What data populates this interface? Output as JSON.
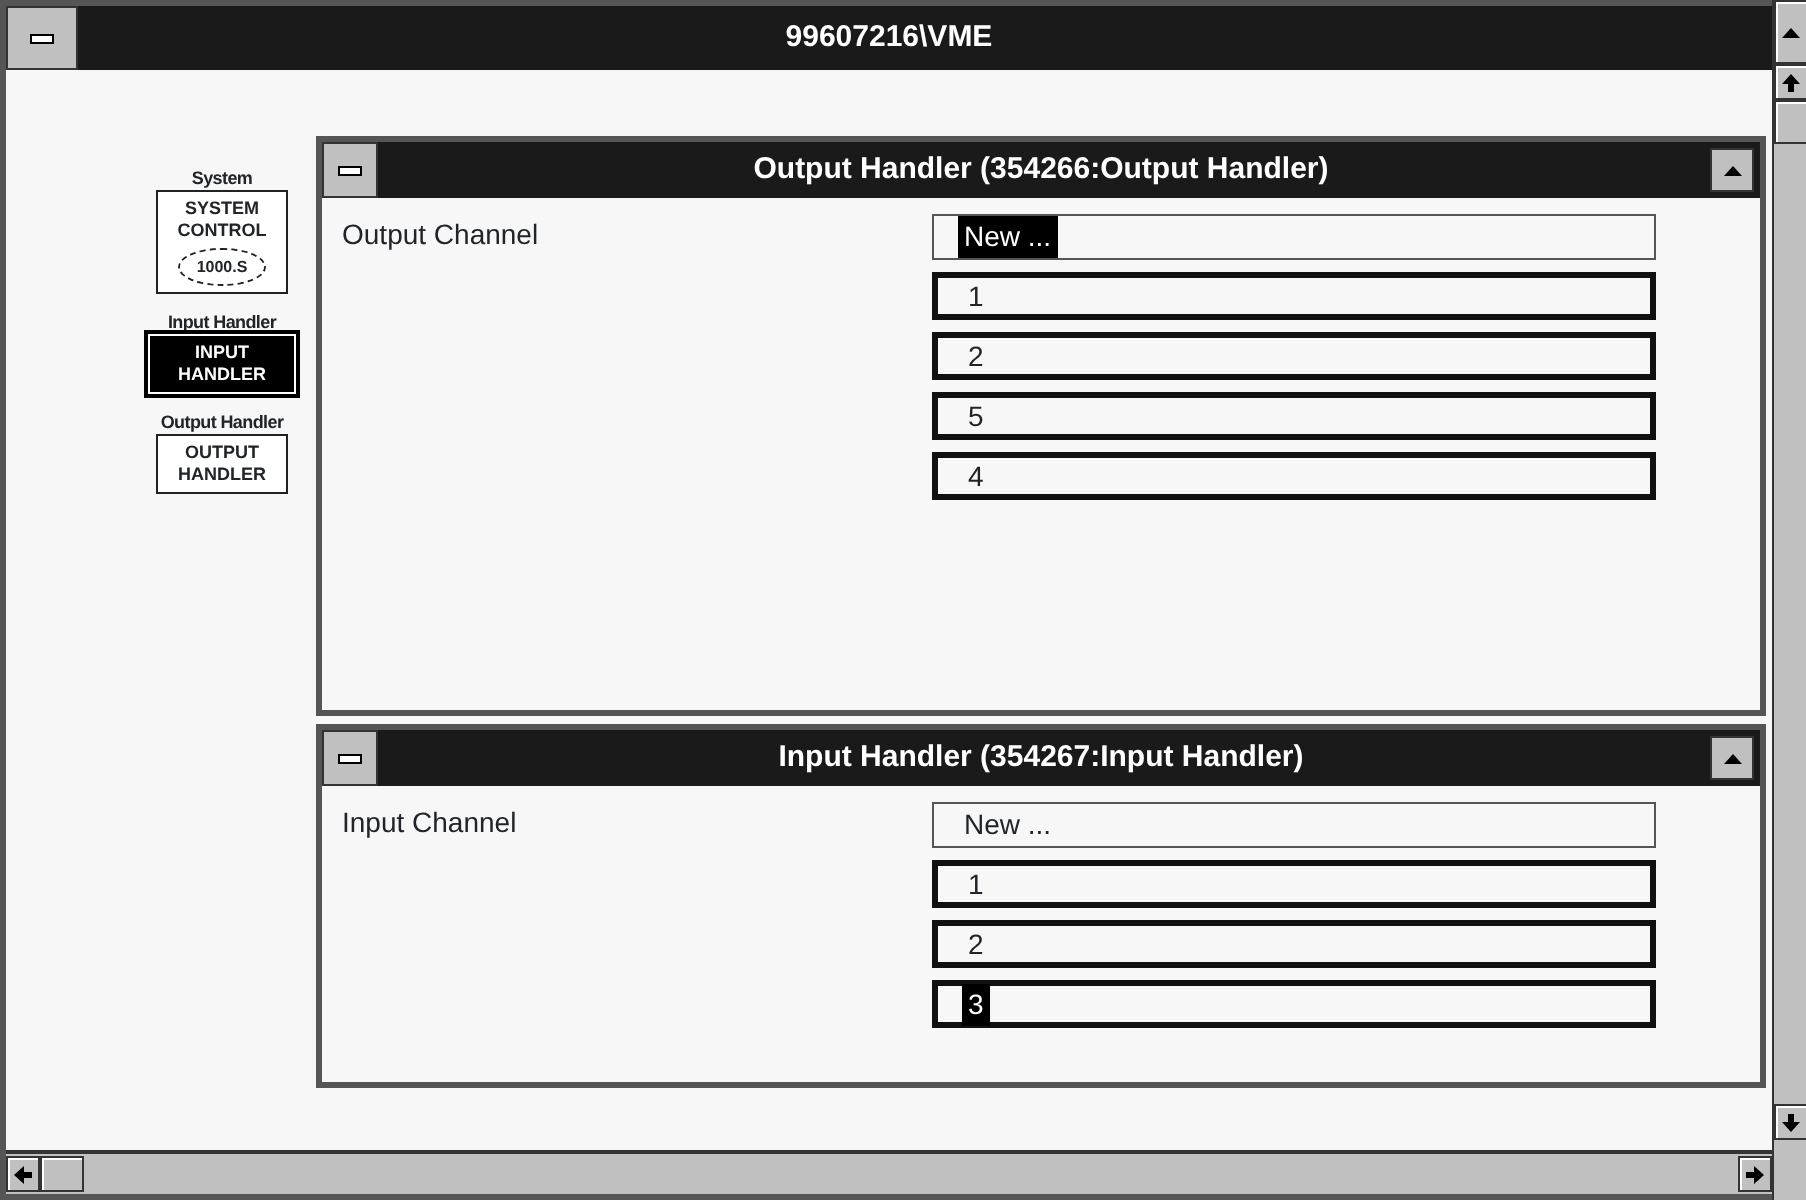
{
  "window": {
    "title": "99607216\\VME"
  },
  "icons": [
    {
      "label": "System",
      "lines": [
        "SYSTEM",
        "CONTROL"
      ],
      "badge": "1000.S",
      "selected": false
    },
    {
      "label": "Input Handler",
      "lines": [
        "INPUT",
        "HANDLER"
      ],
      "selected": true
    },
    {
      "label": "Output Handler",
      "lines": [
        "OUTPUT",
        "HANDLER"
      ],
      "selected": false
    }
  ],
  "child_windows": [
    {
      "title": "Output Handler (354266:Output Handler)",
      "field_label": "Output Channel",
      "entries": [
        {
          "kind": "new",
          "text": "New ...",
          "selected": true
        },
        {
          "kind": "channel",
          "text": "1",
          "selected": false
        },
        {
          "kind": "channel",
          "text": "2",
          "selected": false
        },
        {
          "kind": "channel",
          "text": "5",
          "selected": false
        },
        {
          "kind": "channel",
          "text": "4",
          "selected": false
        }
      ]
    },
    {
      "title": "Input Handler (354267:Input Handler)",
      "field_label": "Input Channel",
      "entries": [
        {
          "kind": "new",
          "text": "New ...",
          "selected": false
        },
        {
          "kind": "channel",
          "text": "1",
          "selected": false
        },
        {
          "kind": "channel",
          "text": "2",
          "selected": false
        },
        {
          "kind": "channel",
          "text": "3",
          "selected": true
        }
      ]
    }
  ]
}
